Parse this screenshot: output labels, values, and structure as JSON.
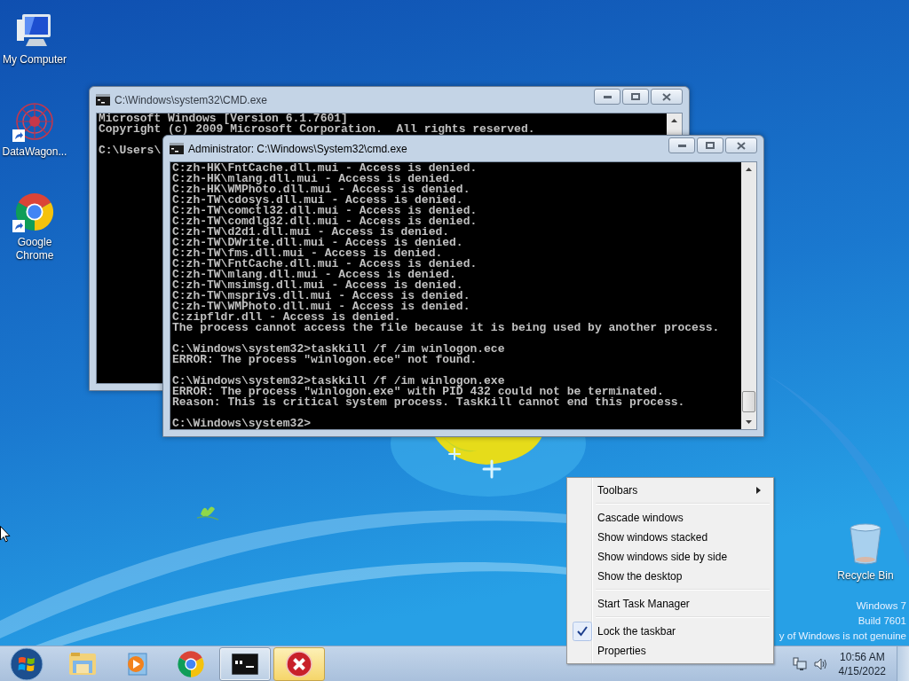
{
  "desktop_icons": [
    {
      "label": "My Computer",
      "kind": "computer",
      "shortcut": false
    },
    {
      "label": "DataWagon...",
      "kind": "datawagon",
      "shortcut": true
    },
    {
      "label": "Google Chrome",
      "kind": "chrome",
      "shortcut": true
    },
    {
      "label": "Recycle Bin",
      "kind": "recycle",
      "shortcut": false
    }
  ],
  "windows": [
    {
      "title": "C:\\Windows\\system32\\CMD.exe",
      "active": false,
      "blocks": [
        [
          "Microsoft Windows [Version 6.1.7601]",
          "Copyright (c) 2009 Microsoft Corporation.  All rights reserved."
        ],
        [
          "C:\\Users\\"
        ]
      ]
    },
    {
      "title": "Administrator: C:\\Windows\\System32\\cmd.exe",
      "active": true,
      "blocks": [
        [
          "C:zh-HK\\FntCache.dll.mui - Access is denied.",
          "C:zh-HK\\mlang.dll.mui - Access is denied.",
          "C:zh-HK\\WMPhoto.dll.mui - Access is denied.",
          "C:zh-TW\\cdosys.dll.mui - Access is denied.",
          "C:zh-TW\\comctl32.dll.mui - Access is denied.",
          "C:zh-TW\\comdlg32.dll.mui - Access is denied.",
          "C:zh-TW\\d2d1.dll.mui - Access is denied.",
          "C:zh-TW\\DWrite.dll.mui - Access is denied.",
          "C:zh-TW\\fms.dll.mui - Access is denied.",
          "C:zh-TW\\FntCache.dll.mui - Access is denied.",
          "C:zh-TW\\mlang.dll.mui - Access is denied.",
          "C:zh-TW\\msimsg.dll.mui - Access is denied.",
          "C:zh-TW\\msprivs.dll.mui - Access is denied.",
          "C:zh-TW\\WMPhoto.dll.mui - Access is denied.",
          "C:zipfldr.dll - Access is denied.",
          "The process cannot access the file because it is being used by another process."
        ],
        [
          "C:\\Windows\\system32>taskkill /f /im winlogon.ece",
          "ERROR: The process \"winlogon.ece\" not found."
        ],
        [
          "C:\\Windows\\system32>taskkill /f /im winlogon.exe",
          "ERROR: The process \"winlogon.exe\" with PID 432 could not be terminated.",
          "Reason: This is critical system process. Taskkill cannot end this process."
        ],
        [
          "C:\\Windows\\system32>"
        ]
      ]
    }
  ],
  "context_menu": {
    "items": [
      {
        "kind": "submenu",
        "label": "Toolbars",
        "checked": false
      },
      {
        "kind": "separator"
      },
      {
        "kind": "item",
        "label": "Cascade windows",
        "checked": false
      },
      {
        "kind": "item",
        "label": "Show windows stacked",
        "checked": false
      },
      {
        "kind": "item",
        "label": "Show windows side by side",
        "checked": false
      },
      {
        "kind": "item",
        "label": "Show the desktop",
        "checked": false
      },
      {
        "kind": "separator"
      },
      {
        "kind": "item",
        "label": "Start Task Manager",
        "checked": false
      },
      {
        "kind": "separator"
      },
      {
        "kind": "item",
        "label": "Lock the taskbar",
        "checked": true
      },
      {
        "kind": "item",
        "label": "Properties",
        "checked": false
      }
    ]
  },
  "genuine_notice": [
    "Windows 7",
    "Build 7601",
    "y of Windows is not genuine"
  ],
  "taskbar": {
    "buttons": [
      {
        "kind": "explorer",
        "selected": false,
        "flashing": false
      },
      {
        "kind": "media",
        "selected": false,
        "flashing": false
      },
      {
        "kind": "chrome",
        "selected": false,
        "flashing": false
      },
      {
        "kind": "console",
        "selected": true,
        "flashing": false
      },
      {
        "kind": "error",
        "selected": false,
        "flashing": true
      }
    ],
    "time": "10:56 AM",
    "date": "4/15/2022"
  }
}
